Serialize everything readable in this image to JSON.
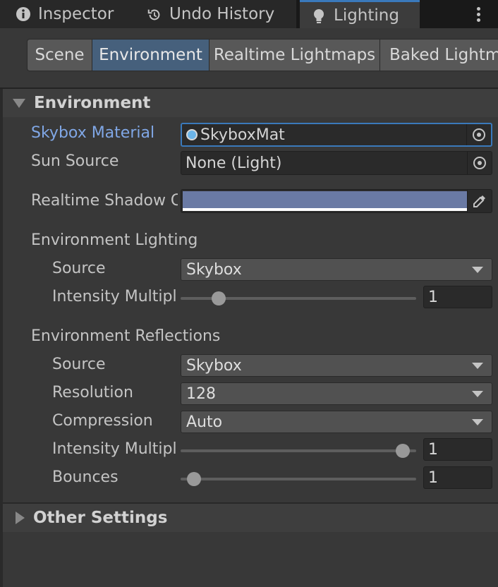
{
  "window_tabs": [
    {
      "label": "Inspector",
      "icon": "info-icon"
    },
    {
      "label": "Undo History",
      "icon": "history-icon"
    },
    {
      "label": "Lighting",
      "icon": "lightbulb-icon"
    }
  ],
  "sub_tabs": [
    "Scene",
    "Environment",
    "Realtime Lightmaps",
    "Baked Lightmaps"
  ],
  "active_sub_tab": "Environment",
  "environment": {
    "header": "Environment",
    "skybox_material": {
      "label": "Skybox Material",
      "value": "SkyboxMat"
    },
    "sun_source": {
      "label": "Sun Source",
      "value": "None (Light)"
    },
    "realtime_shadow_color": {
      "label": "Realtime Shadow Color",
      "color": "#6a7aa4"
    },
    "lighting": {
      "header": "Environment Lighting",
      "source": {
        "label": "Source",
        "value": "Skybox"
      },
      "intensity": {
        "label": "Intensity Multiplier",
        "value": "1",
        "slider_fraction": 0.14
      }
    },
    "reflections": {
      "header": "Environment Reflections",
      "source": {
        "label": "Source",
        "value": "Skybox"
      },
      "resolution": {
        "label": "Resolution",
        "value": "128"
      },
      "compression": {
        "label": "Compression",
        "value": "Auto"
      },
      "intensity": {
        "label": "Intensity Multiplier",
        "value": "1",
        "slider_fraction": 0.97
      },
      "bounces": {
        "label": "Bounces",
        "value": "1",
        "slider_fraction": 0.03
      }
    }
  },
  "other_settings": {
    "header": "Other Settings"
  },
  "colors": {
    "accent": "#3a79bb",
    "active_tab": "#46607c",
    "highlight_label": "#80a7e6"
  }
}
